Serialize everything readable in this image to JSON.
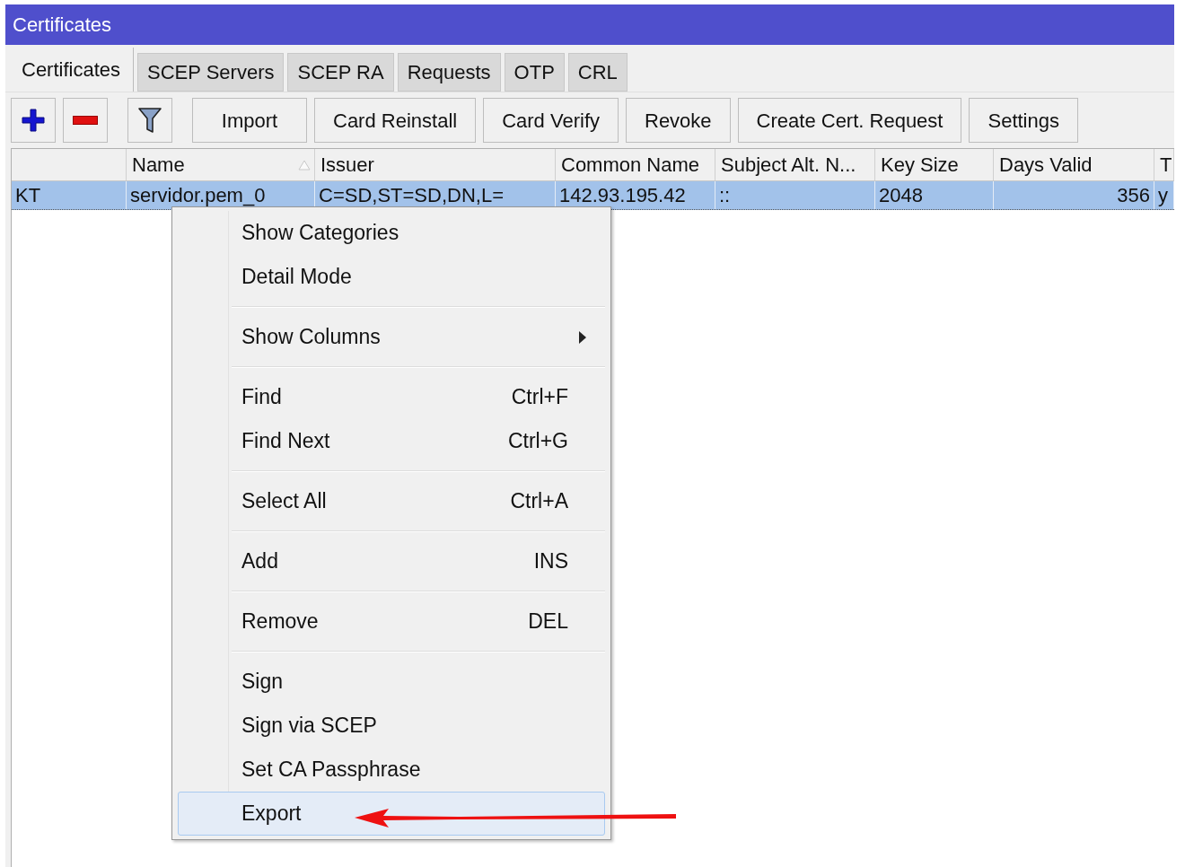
{
  "window": {
    "title": "Certificates"
  },
  "tabs": [
    {
      "label": "Certificates",
      "selected": true
    },
    {
      "label": "SCEP Servers",
      "selected": false
    },
    {
      "label": "SCEP RA",
      "selected": false
    },
    {
      "label": "Requests",
      "selected": false
    },
    {
      "label": "OTP",
      "selected": false
    },
    {
      "label": "CRL",
      "selected": false
    }
  ],
  "toolbar": {
    "icon_buttons": [
      {
        "kind": "add"
      },
      {
        "kind": "remove"
      },
      {
        "kind": "filter"
      }
    ],
    "buttons": [
      "Import",
      "Card Reinstall",
      "Card Verify",
      "Revoke",
      "Create Cert. Request",
      "Settings"
    ]
  },
  "table": {
    "columns": [
      {
        "sorted": false
      },
      {
        "label": "Name",
        "sorted": true
      },
      {
        "label": "Issuer",
        "sorted": false
      },
      {
        "label": "Common Name",
        "sorted": false
      },
      {
        "label": "Subject Alt. N...",
        "sorted": false
      },
      {
        "label": "Key Size",
        "sorted": false
      },
      {
        "label": "Days Valid",
        "sorted": false
      },
      {
        "label": "T",
        "sorted": false
      }
    ],
    "rows": [
      {
        "selected": true,
        "cells": [
          "KT",
          "servidor.pem_0",
          "C=SD,ST=SD,DN,L=",
          "142.93.195.42",
          "::",
          "2048",
          "356",
          "y"
        ]
      }
    ]
  },
  "context_menu": {
    "groups": [
      [
        {
          "label": "Show Categories",
          "selected": false
        },
        {
          "label": "Detail Mode",
          "selected": false
        }
      ],
      [
        {
          "label": "Show Columns",
          "submenu": true,
          "selected": false
        }
      ],
      [
        {
          "label": "Find",
          "shortcut": "Ctrl+F",
          "selected": false
        },
        {
          "label": "Find Next",
          "shortcut": "Ctrl+G",
          "selected": false
        }
      ],
      [
        {
          "label": "Select All",
          "shortcut": "Ctrl+A",
          "selected": false
        }
      ],
      [
        {
          "label": "Add",
          "shortcut": "INS",
          "selected": false
        }
      ],
      [
        {
          "label": "Remove",
          "shortcut": "DEL",
          "selected": false
        }
      ],
      [
        {
          "label": "Sign",
          "selected": false
        },
        {
          "label": "Sign via SCEP",
          "selected": false
        },
        {
          "label": "Set CA Passphrase",
          "selected": false
        },
        {
          "label": "Export",
          "selected": true
        }
      ]
    ]
  }
}
